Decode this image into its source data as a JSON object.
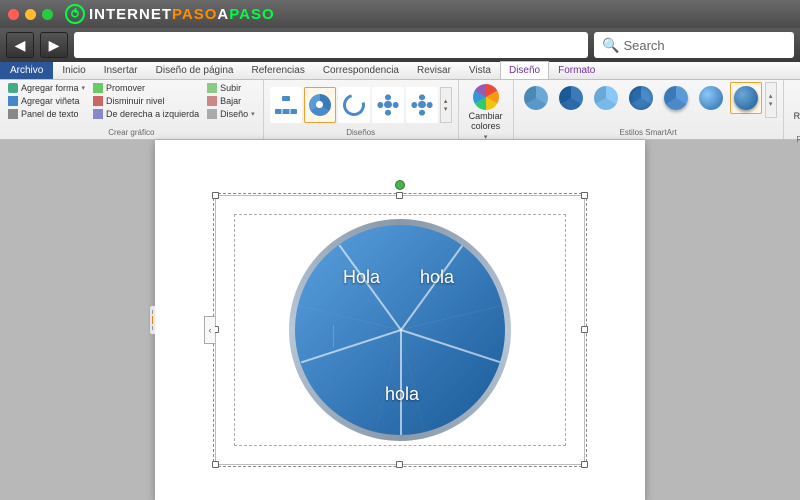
{
  "browser": {
    "logo_white": "INTERNET",
    "logo_orange": "PASO",
    "logo_white2": "A",
    "logo_green": "PASO",
    "search_placeholder": "Search"
  },
  "menu": {
    "file": "Archivo",
    "tabs": [
      "Inicio",
      "Insertar",
      "Diseño de página",
      "Referencias",
      "Correspondencia",
      "Revisar",
      "Vista",
      "Diseño",
      "Formato"
    ]
  },
  "ribbon": {
    "create": {
      "label": "Crear gráfico",
      "add_shape": "Agregar forma",
      "add_bullet": "Agregar viñeta",
      "text_panel": "Panel de texto",
      "promote": "Promover",
      "demote": "Disminuir nivel",
      "rtl": "De derecha a izquierda",
      "up": "Subir",
      "down": "Bajar",
      "layout": "Diseño"
    },
    "layouts": {
      "label": "Diseños"
    },
    "colors": {
      "label": "Cambiar colores"
    },
    "styles": {
      "label": "Estilos SmartArt"
    },
    "reset": {
      "label": "Restablecer",
      "btn": "Restablecer gráfico"
    }
  },
  "smartart": {
    "seg1": "hola",
    "seg2": "",
    "seg3": "hola",
    "seg4": "",
    "seg5": "Hola",
    "text_tab": "‹"
  }
}
